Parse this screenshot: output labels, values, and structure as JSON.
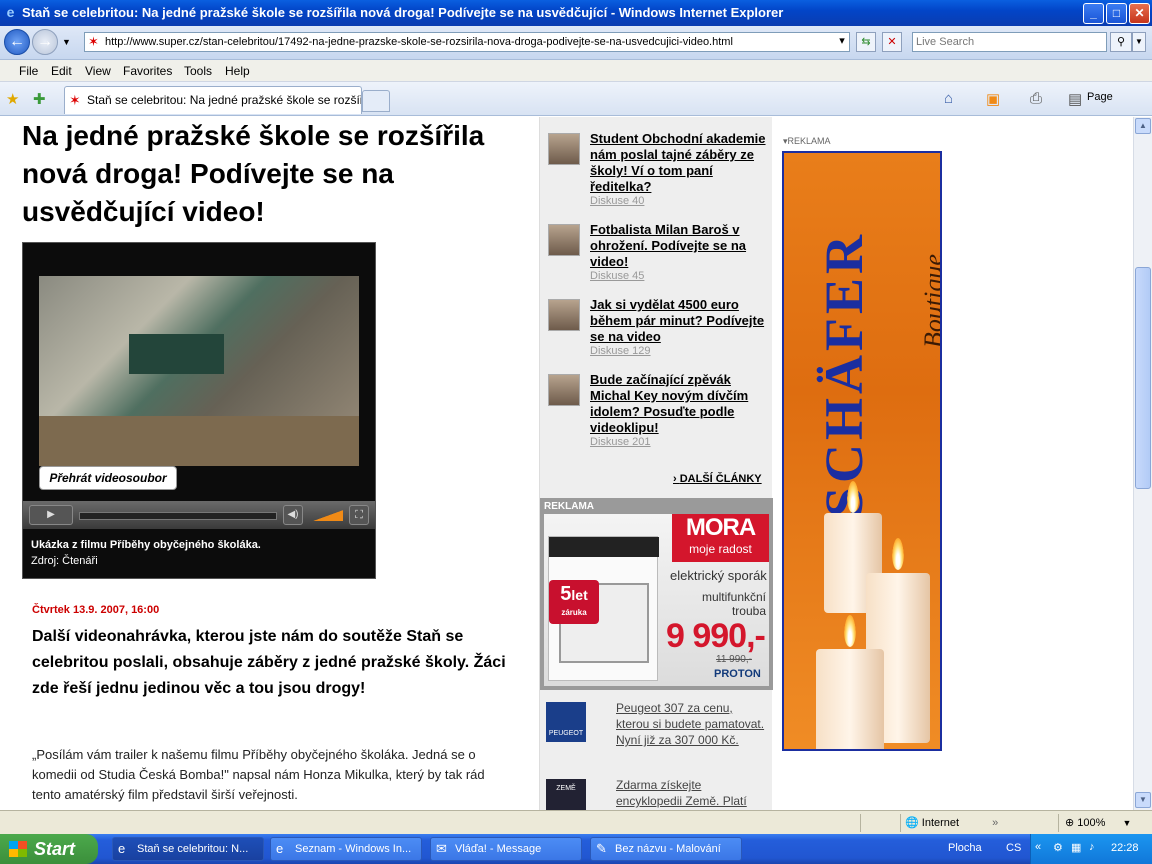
{
  "window": {
    "title": "Staň se celebritou: Na jedné pražské škole se rozšířila nová droga! Podívejte se na usvědčující - Windows Internet Explorer",
    "minimize": "_",
    "maximize": "□",
    "close": "✕"
  },
  "address_bar": {
    "url": "http://www.super.cz/stan-celebritou/17492-na-jedne-prazske-skole-se-rozsirila-nova-droga-podivejte-se-na-usvedcujici-video.html",
    "search_placeholder": "Live Search"
  },
  "menu": [
    "File",
    "Edit",
    "View",
    "Favorites",
    "Tools",
    "Help"
  ],
  "tabs": {
    "active_label": "Staň se celebritou: Na jedné pražské škole se rozšíř...",
    "page_button": "Page"
  },
  "article": {
    "headline": "Na jedné pražské škole se rozšířila nová droga! Podívejte se na usvědčující video!",
    "video_tooltip": "Přehrát videosoubor",
    "video_caption": "Ukázka z filmu Příběhy obyčejného školáka.",
    "video_source": "Zdroj: Čtenáři",
    "date": "Čtvrtek 13.9. 2007, 16:00",
    "lead": "Další videonahrávka, kterou jste nám do soutěže Staň se celebritou poslali, obsahuje záběry z jedné pražské školy. Žáci zde řeší jednu jedinou věc a tou jsou drogy!",
    "body": "„Posílám vám trailer k našemu filmu Příběhy obyčejného školáka. Jedná se o komedii od Studia Česká Bomba!\" napsal nám Honza Mikulka, který by tak rád tento amatérský film představil širší veřejnosti."
  },
  "sidebar": {
    "articles": [
      {
        "title": "Student Obchodní akademie nám poslal tajné záběry ze školy! Ví o tom paní ředitelka?",
        "discussion": "Diskuse 40"
      },
      {
        "title": "Fotbalista Milan Baroš v ohrožení. Podívejte se na video!",
        "discussion": "Diskuse 45"
      },
      {
        "title": "Jak si vydělat 4500 euro během pár minut? Podívejte se na video",
        "discussion": "Diskuse 129"
      },
      {
        "title": "Bude začínající zpěvák Michal Key novým dívčím idolem? Posuďte podle videoklipu!",
        "discussion": "Diskuse 201"
      }
    ],
    "more_articles": "DALŠÍ ČLÁNKY",
    "ad_label": "REKLAMA",
    "mora_ad": {
      "brand": "MORA",
      "slogan": "moje radost",
      "product": "elektrický sporák",
      "feature": "multifunkční trouba",
      "price": "9 990,-",
      "old_price": "11 990,-",
      "warranty_number": "5",
      "warranty_unit": "let",
      "warranty_word": "záruka",
      "retailer": "PROTON"
    },
    "promos": [
      {
        "icon_label": "PEUGEOT",
        "text": "Peugeot 307 za cenu, kterou si budete pamatovat. Nyní již za 307 000 Kč."
      },
      {
        "icon_label": "ZEMĚ",
        "text": "Zdarma získejte encyklopedii Země. Platí"
      }
    ]
  },
  "right_ad": {
    "label": "REKLAMA",
    "brand": "SCHÄFER",
    "subbrand": "Boutique"
  },
  "statusbar": {
    "zone": "Internet",
    "zoom": "100%"
  },
  "taskbar": {
    "start": "Start",
    "items": [
      "Staň se celebritou: N...",
      "Seznam - Windows In...",
      "Vláďa! - Message",
      "Bez názvu - Malování"
    ],
    "tray_desktop": "Plocha",
    "tray_lang": "CS",
    "clock": "22:28"
  },
  "colors": {
    "title_blue": "#0245c8",
    "date_red": "#cc0000",
    "mora_red": "#d4162c",
    "schafer_blue": "#1b2ea0",
    "schafer_orange": "#e97e1a",
    "start_green": "#3b8f3b"
  }
}
